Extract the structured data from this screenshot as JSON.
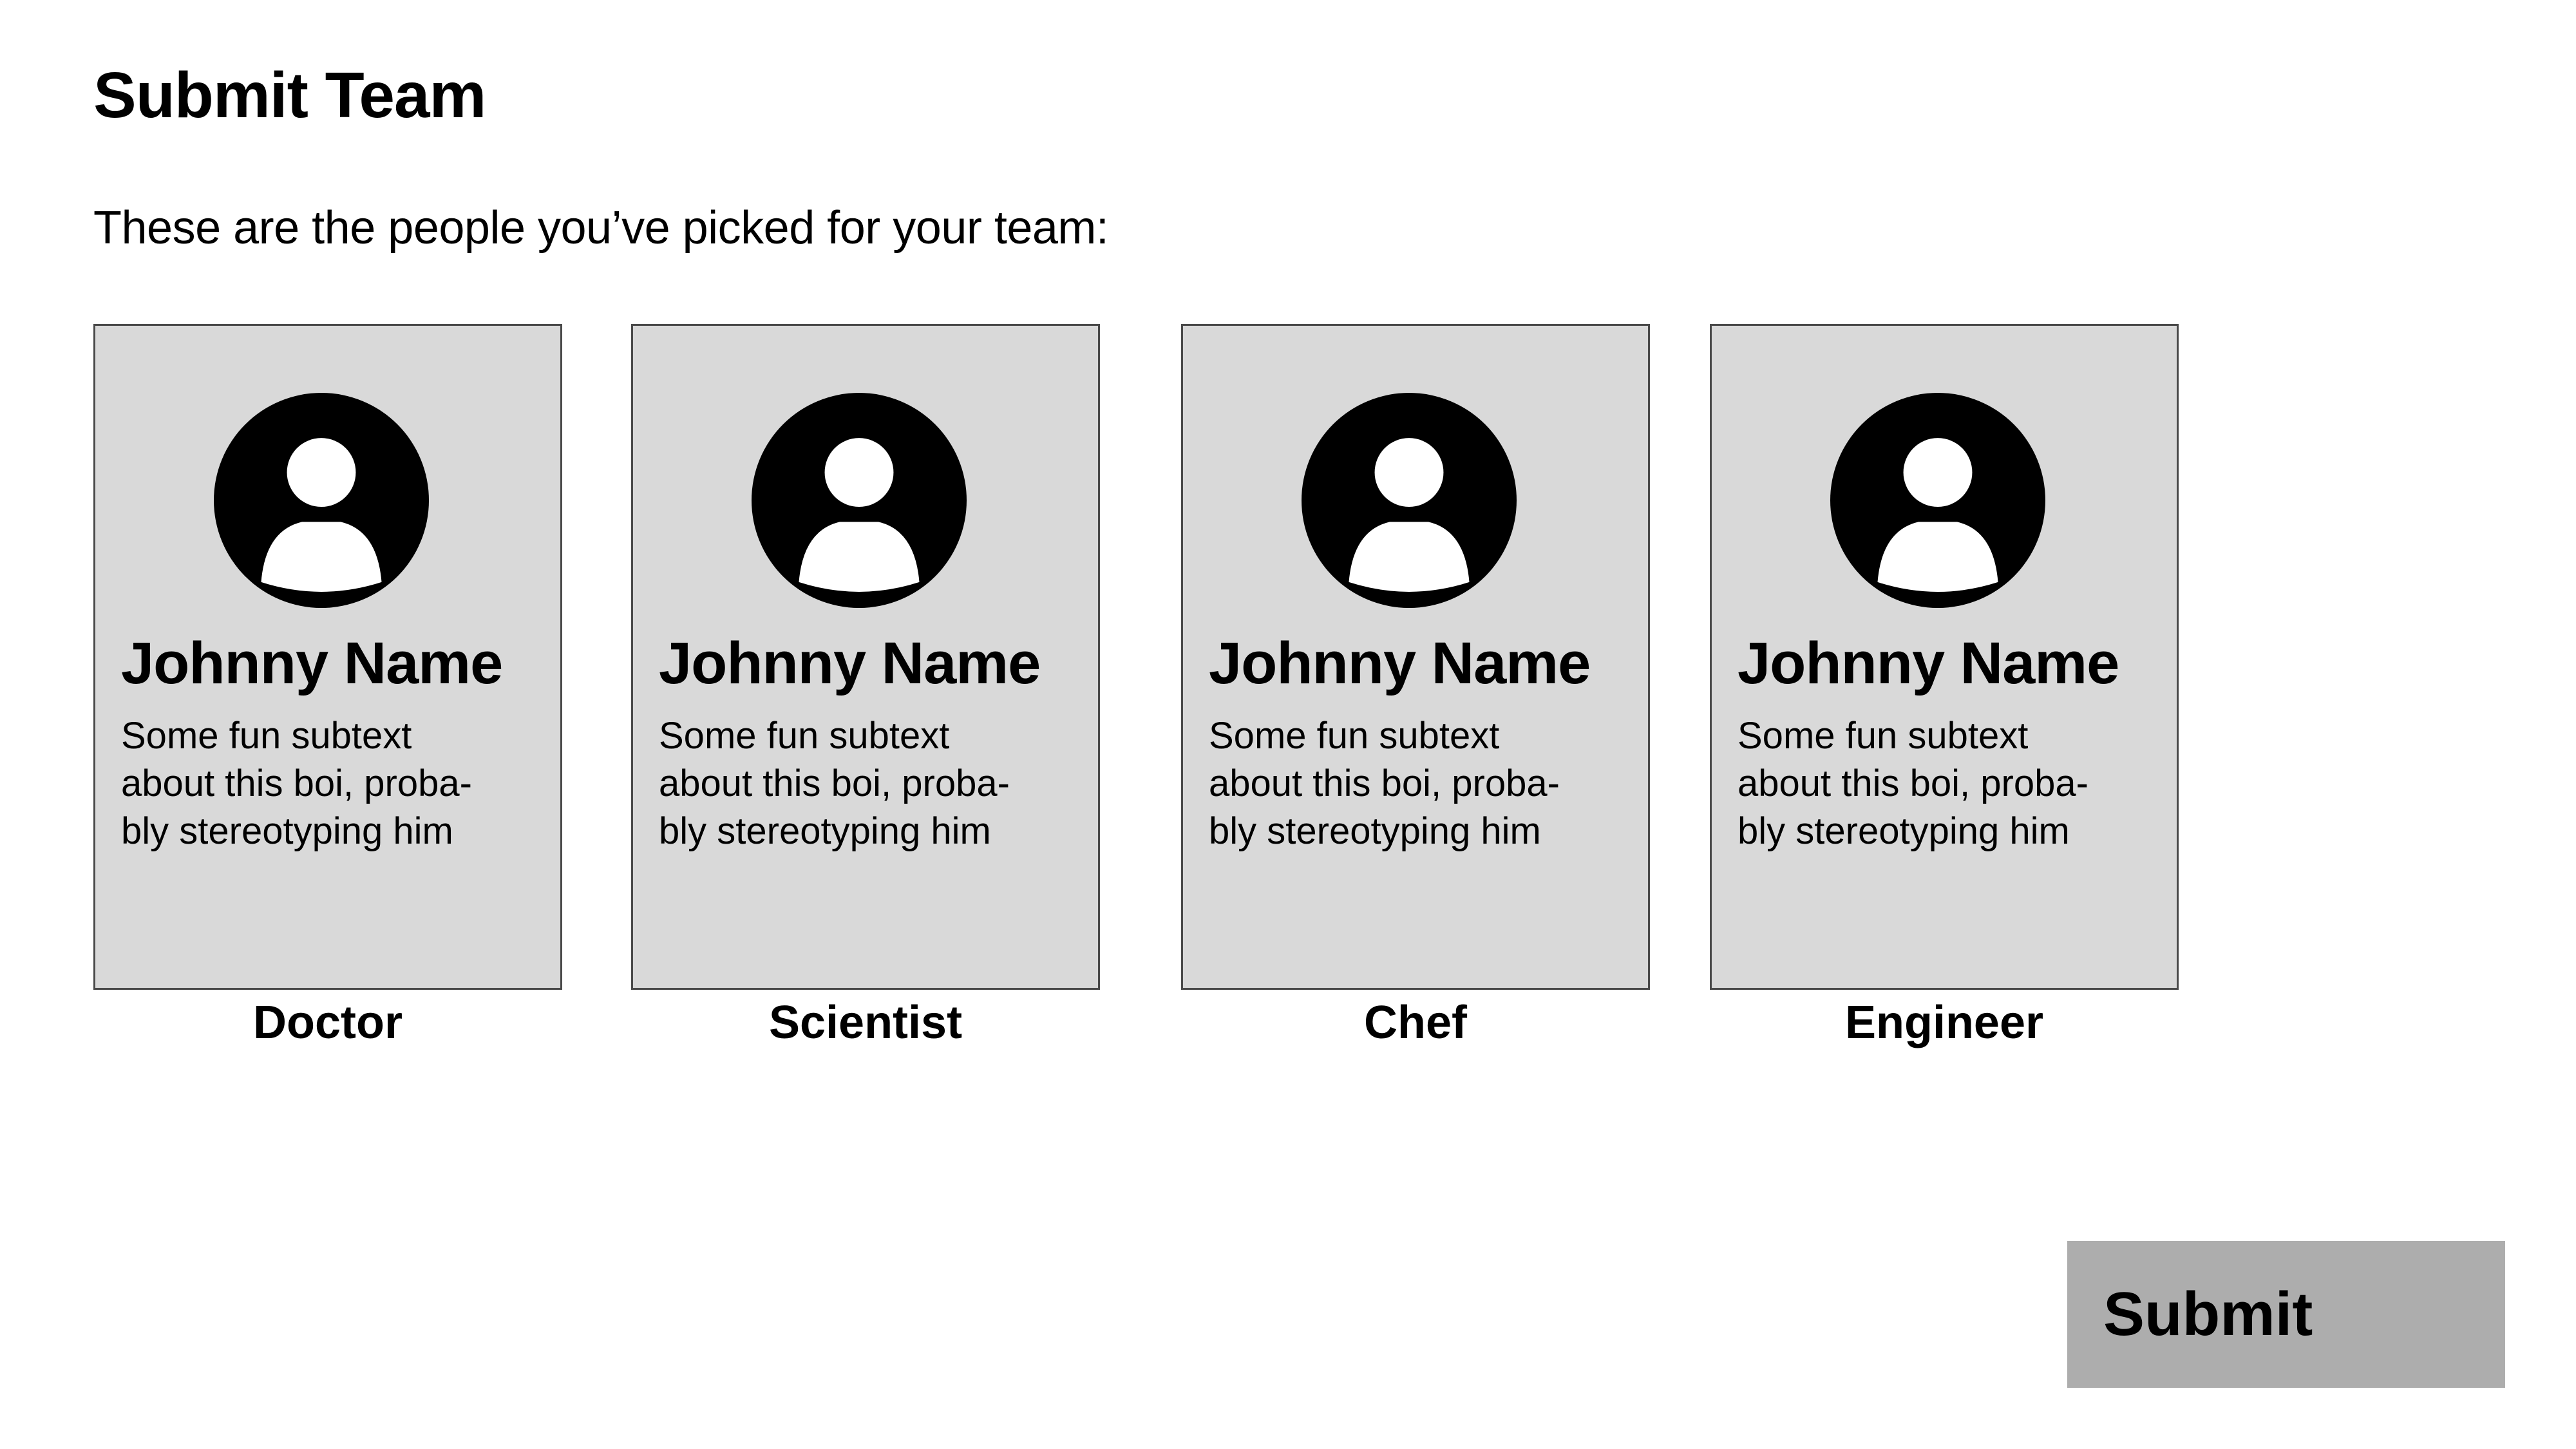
{
  "page": {
    "title": "Submit Team",
    "intro": "These are the people you’ve picked for your team:"
  },
  "team": [
    {
      "name": "Johnny Name",
      "description": "Some fun subtext\nabout this boi, proba-\nbly stereotyping him",
      "role": "Doctor",
      "icon": "user-avatar-icon"
    },
    {
      "name": "Johnny Name",
      "description": "Some fun subtext\nabout this boi, proba-\nbly stereotyping him",
      "role": "Scientist",
      "icon": "user-avatar-icon"
    },
    {
      "name": "Johnny Name",
      "description": "Some fun subtext\nabout this boi, proba-\nbly stereotyping him",
      "role": "Chef",
      "icon": "user-avatar-icon"
    },
    {
      "name": "Johnny Name",
      "description": "Some fun subtext\nabout this boi, proba-\nbly stereotyping him",
      "role": "Engineer",
      "icon": "user-avatar-icon"
    }
  ],
  "actions": {
    "submit_label": "Submit"
  },
  "colors": {
    "card_background": "#d9d9d9",
    "card_border": "#4a4a4a",
    "button_background": "#adadad",
    "text": "#000000"
  }
}
